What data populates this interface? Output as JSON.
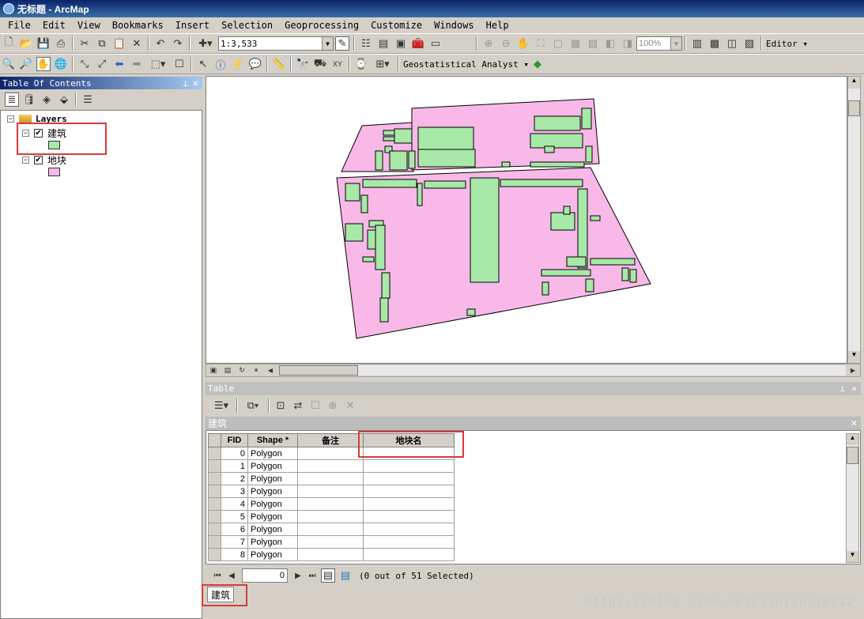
{
  "window": {
    "title": "无标题 - ArcMap"
  },
  "menu": [
    "File",
    "Edit",
    "View",
    "Bookmarks",
    "Insert",
    "Selection",
    "Geoprocessing",
    "Customize",
    "Windows",
    "Help"
  ],
  "toolbar": {
    "scale": "1:3,533",
    "zoom_percent": "100%",
    "editor_label": "Editor ▾",
    "geostat_label": "Geostatistical Analyst ▾"
  },
  "toc": {
    "title": "Table Of Contents",
    "root": "Layers",
    "layers": [
      {
        "name": "建筑",
        "checked": true,
        "color": "#a8e8a8"
      },
      {
        "name": "地块",
        "checked": true,
        "color": "#f8b8e8"
      }
    ]
  },
  "table": {
    "panel_title": "Table",
    "layer_name": "建筑",
    "columns": [
      "FID",
      "Shape *",
      "备注",
      "地块名"
    ],
    "rows": [
      [
        "0",
        "Polygon",
        "",
        ""
      ],
      [
        "1",
        "Polygon",
        "",
        ""
      ],
      [
        "2",
        "Polygon",
        "",
        ""
      ],
      [
        "3",
        "Polygon",
        "",
        ""
      ],
      [
        "4",
        "Polygon",
        "",
        ""
      ],
      [
        "5",
        "Polygon",
        "",
        ""
      ],
      [
        "6",
        "Polygon",
        "",
        ""
      ],
      [
        "7",
        "Polygon",
        "",
        ""
      ],
      [
        "8",
        "Polygon",
        "",
        ""
      ]
    ],
    "record_value": "0",
    "selection_status": "(0 out of 51 Selected)",
    "bottom_tab": "建筑"
  },
  "watermark": "https://blog.csdn.net/liujinli0712",
  "colors": {
    "parcel": "#f8b8e8",
    "building": "#a8e8a8",
    "highlight": "#d93a3a"
  }
}
